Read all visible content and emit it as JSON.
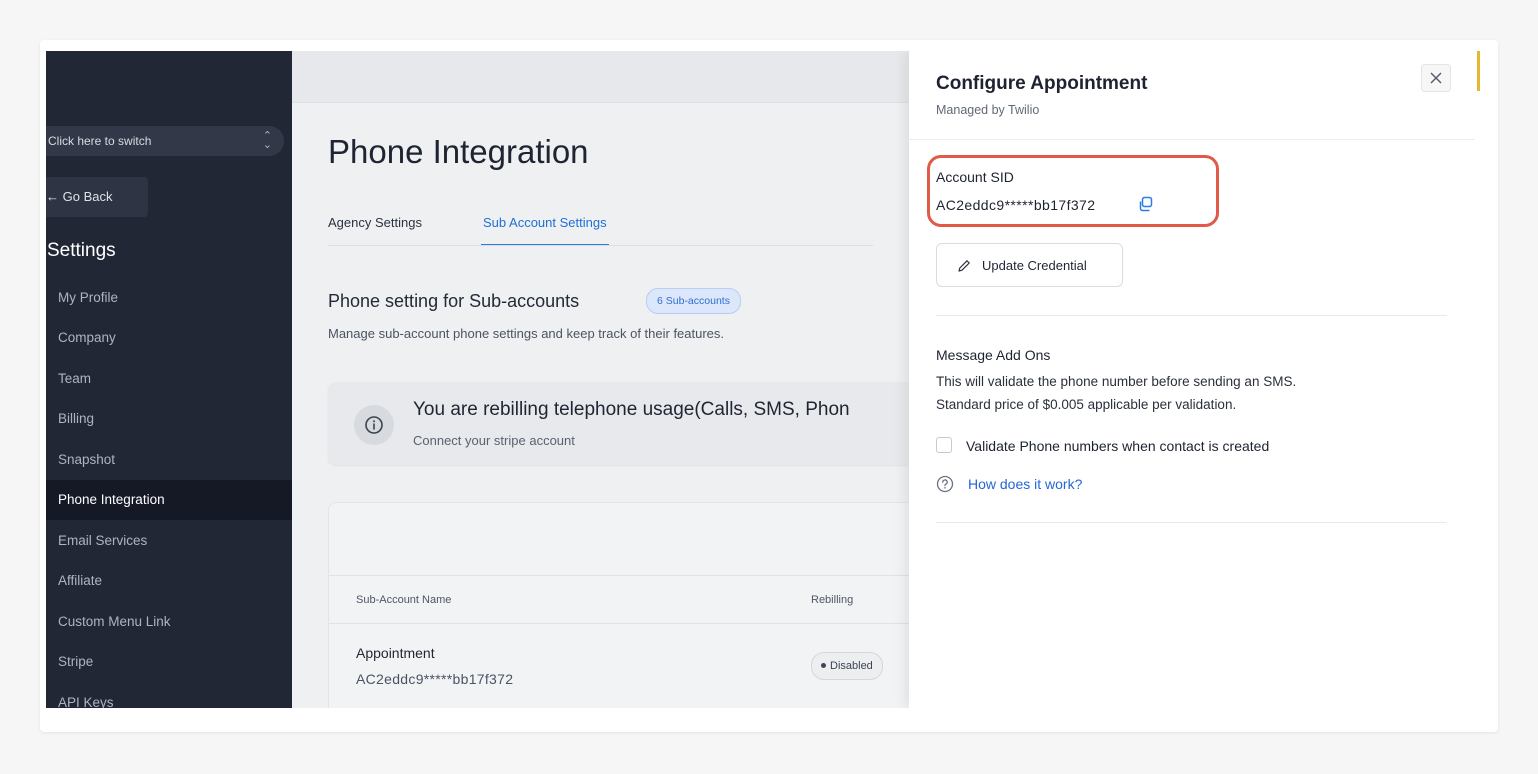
{
  "sidebar": {
    "switcher_label": "Click here to switch",
    "go_back": "← Go Back",
    "settings_title": "Settings",
    "items": [
      {
        "label": "My Profile",
        "active": false
      },
      {
        "label": "Company",
        "active": false
      },
      {
        "label": "Team",
        "active": false
      },
      {
        "label": "Billing",
        "active": false
      },
      {
        "label": "Snapshot",
        "active": false
      },
      {
        "label": "Phone Integration",
        "active": true
      },
      {
        "label": "Email Services",
        "active": false
      },
      {
        "label": "Affiliate",
        "active": false
      },
      {
        "label": "Custom Menu Link",
        "active": false
      },
      {
        "label": "Stripe",
        "active": false
      },
      {
        "label": "API Keys",
        "active": false
      }
    ]
  },
  "main": {
    "page_title": "Phone Integration",
    "tabs": [
      {
        "label": "Agency Settings",
        "active": false
      },
      {
        "label": "Sub Account Settings",
        "active": true
      }
    ],
    "section_title": "Phone setting for Sub-accounts",
    "count_badge": "6 Sub-accounts",
    "section_desc": "Manage sub-account phone settings and keep track of their features.",
    "alert": {
      "title": "You are rebilling telephone usage(Calls, SMS, Phon",
      "subtitle": "Connect your stripe account"
    },
    "table": {
      "columns": [
        "Sub-Account Name",
        "Rebilling"
      ],
      "rows": [
        {
          "name": "Appointment",
          "sid": "AC2eddc9*****bb17f372",
          "status": "Disabled"
        }
      ]
    }
  },
  "drawer": {
    "title": "Configure Appointment",
    "subtitle": "Managed by Twilio",
    "account_sid_label": "Account SID",
    "account_sid_value": "AC2eddc9*****bb17f372",
    "update_button": "Update Credential",
    "addons_title": "Message Add Ons",
    "addons_desc_line1": "This will validate the phone number before sending an SMS.",
    "addons_desc_line2": "Standard price of $0.005 applicable per validation.",
    "checkbox_label": "Validate Phone numbers when contact is created",
    "checkbox_checked": false,
    "help_link": "How does it work?"
  },
  "colors": {
    "sidebar_bg": "#212735",
    "accent": "#2b7ce8",
    "highlight_border": "#e05a47"
  }
}
